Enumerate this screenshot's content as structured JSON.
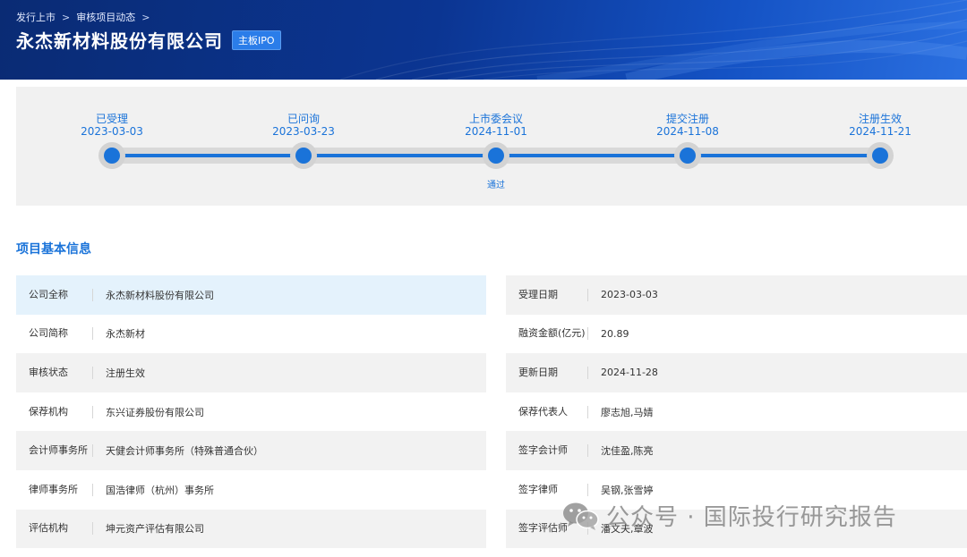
{
  "breadcrumb": {
    "items": [
      "发行上市",
      "审核项目动态"
    ],
    "separator": ">"
  },
  "header": {
    "company_name": "永杰新材料股份有限公司",
    "board_badge": "主板IPO"
  },
  "timeline": {
    "stages": [
      {
        "label": "已受理",
        "date": "2023-03-03"
      },
      {
        "label": "已问询",
        "date": "2023-03-23"
      },
      {
        "label": "上市委会议",
        "date": "2024-11-01",
        "note": "通过"
      },
      {
        "label": "提交注册",
        "date": "2024-11-08"
      },
      {
        "label": "注册生效",
        "date": "2024-11-21"
      }
    ]
  },
  "section": {
    "title": "项目基本信息"
  },
  "info_left": [
    {
      "label": "公司全称",
      "value": "永杰新材料股份有限公司"
    },
    {
      "label": "公司简称",
      "value": "永杰新材"
    },
    {
      "label": "审核状态",
      "value": "注册生效"
    },
    {
      "label": "保荐机构",
      "value": "东兴证券股份有限公司"
    },
    {
      "label": "会计师事务所",
      "value": "天健会计师事务所（特殊普通合伙）"
    },
    {
      "label": "律师事务所",
      "value": "国浩律师（杭州）事务所"
    },
    {
      "label": "评估机构",
      "value": "坤元资产评估有限公司"
    }
  ],
  "info_right": [
    {
      "label": "受理日期",
      "value": "2023-03-03"
    },
    {
      "label": "融资金额(亿元)",
      "value": "20.89"
    },
    {
      "label": "更新日期",
      "value": "2024-11-28"
    },
    {
      "label": "保荐代表人",
      "value": "廖志旭,马婧"
    },
    {
      "label": "签字会计师",
      "value": "沈佳盈,陈亮"
    },
    {
      "label": "签字律师",
      "value": "吴钢,张雪婷"
    },
    {
      "label": "签字评估师",
      "value": "潘文夫,章波"
    }
  ],
  "watermark": {
    "text": "公众号 · 国际投行研究报告",
    "icon": "wechat-icon"
  },
  "colors": {
    "header_dark": "#0a2b74",
    "header_light": "#2a6fe0",
    "accent": "#1a73d9",
    "badge": "#2b7de9",
    "row_shade": "#f2f2f2",
    "row_highlight": "#e4f2fc"
  }
}
